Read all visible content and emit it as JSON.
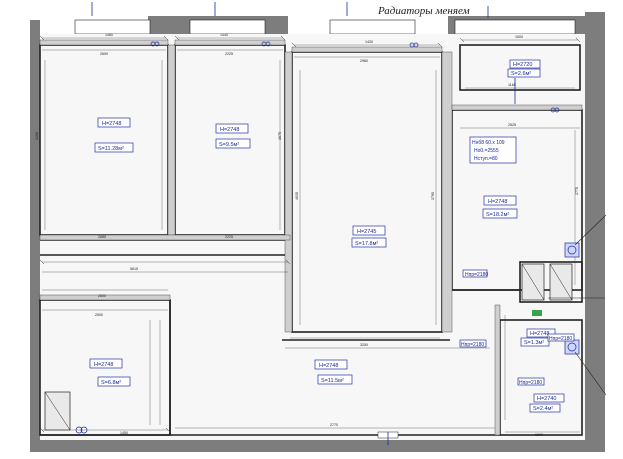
{
  "title": "Радиаторы меняем",
  "colors": {
    "wall": "#7d7d7d",
    "floor": "#f7f7f7",
    "line": "#222222",
    "blue": "#1a2a9a"
  },
  "rooms": [
    {
      "id": "bedroom-1",
      "h": "H=2748",
      "s": "S=11.28м²"
    },
    {
      "id": "bedroom-2",
      "h": "H=2748",
      "s": "S=9.5м²"
    },
    {
      "id": "living",
      "h": "H=2745",
      "s": "S=17.8м²"
    },
    {
      "id": "kitchen",
      "h": "H=2748",
      "s": "S=18.2м²"
    },
    {
      "id": "balcony",
      "h": "H=2720",
      "s": "S=2.6м²"
    },
    {
      "id": "room-sw",
      "h": "H=2748",
      "s": "S=6.8м²"
    },
    {
      "id": "hall",
      "h": "H=2748",
      "s": "S=11.5м²"
    },
    {
      "id": "bath",
      "h": "H=2748",
      "s": "S=1.3м²"
    },
    {
      "id": "toilet",
      "h": "H=2740",
      "s": "S=2.4м²"
    }
  ],
  "notes": {
    "kitchen_window": [
      "Hнб8 60.х 109",
      "Hо0.=2555",
      "Hступ.=80"
    ],
    "hvp_1": "Hпр=2180",
    "hvp_2": "Hпр=2180",
    "hvp_3": "Hпр=2180",
    "hvp_4": "Hпр=2180"
  },
  "dimensions": {
    "top_1": "1460",
    "top_2": "1440",
    "top_3": "1430",
    "top_4": "1500",
    "r1_w": "2690",
    "r2_w": "2225",
    "r3_w": "2960",
    "bal_w": "1165",
    "r1_h": "4190",
    "r2_h": "3675",
    "r3_h": "4635",
    "r4_h": "3795",
    "mid_1": "2685",
    "mid_2": "2225",
    "mid_3": "5615",
    "low_1": "2600",
    "low_2": "2500",
    "low_3": "3250",
    "bot_1": "1450",
    "bot_2": "2770",
    "bot_3": "1500",
    "k_w": "2525",
    "k_h": "2775"
  }
}
